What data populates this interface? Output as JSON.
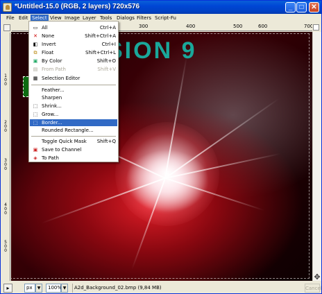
{
  "window": {
    "title": "*Untitled-15.0 (RGB, 2 layers) 720x576",
    "min_label": "_",
    "max_label": "□",
    "close_label": "✕"
  },
  "menubar": {
    "items": [
      "File",
      "Edit",
      "Select",
      "View",
      "Image",
      "Layer",
      "Tools",
      "Dialogs",
      "Filters",
      "Script-Fu"
    ],
    "active": "Select"
  },
  "ruler": {
    "h_labels": [
      "300",
      "400",
      "500",
      "600",
      "700"
    ],
    "v_labels": [
      "1",
      "0",
      "0",
      "2",
      "0",
      "0",
      "3",
      "0",
      "0",
      "4",
      "0",
      "0",
      "5",
      "0",
      "0"
    ]
  },
  "canvas": {
    "text": "SION 9"
  },
  "select_menu": {
    "items": [
      {
        "label": "All",
        "accel": "Ctrl+A",
        "icon": "select-all-icon",
        "glyph": "▭"
      },
      {
        "label": "None",
        "accel": "Shift+Ctrl+A",
        "icon": "select-none-icon",
        "glyph": "✕"
      },
      {
        "label": "Invert",
        "accel": "Ctrl+I",
        "icon": "invert-icon",
        "glyph": "◧"
      },
      {
        "label": "Float",
        "accel": "Shift+Ctrl+L",
        "icon": "float-icon",
        "glyph": "⧉"
      },
      {
        "label": "By Color",
        "accel": "Shift+O",
        "icon": "by-color-icon",
        "glyph": "▣"
      },
      {
        "label": "From Path",
        "accel": "Shift+V",
        "icon": "from-path-icon",
        "glyph": "▤",
        "disabled": true
      },
      {
        "label": "Selection Editor",
        "accel": "",
        "icon": "selection-editor-icon",
        "glyph": "▦"
      },
      {
        "label": "Feather...",
        "accel": ""
      },
      {
        "label": "Sharpen",
        "accel": ""
      },
      {
        "label": "Shrink...",
        "accel": "",
        "icon": "shrink-icon",
        "glyph": "⬚"
      },
      {
        "label": "Grow...",
        "accel": "",
        "icon": "grow-icon",
        "glyph": "⬚"
      },
      {
        "label": "Border...",
        "accel": "",
        "icon": "border-icon",
        "glyph": "⬚",
        "highlighted": true
      },
      {
        "label": "Rounded Rectangle...",
        "accel": ""
      },
      {
        "label": "Toggle Quick Mask",
        "accel": "Shift+Q"
      },
      {
        "label": "Save to Channel",
        "accel": "",
        "icon": "save-channel-icon",
        "glyph": "▣"
      },
      {
        "label": "To Path",
        "accel": "",
        "icon": "to-path-icon",
        "glyph": "◈"
      }
    ]
  },
  "status": {
    "unit": "px",
    "zoom": "100%",
    "file": "A2d_Background_02.bmp (9,84 MB)",
    "cancel": "Cancel"
  },
  "colors": {
    "titlebar": "#0046d5",
    "menu_highlight": "#316ac5",
    "canvas_text": "#1aa79a"
  }
}
